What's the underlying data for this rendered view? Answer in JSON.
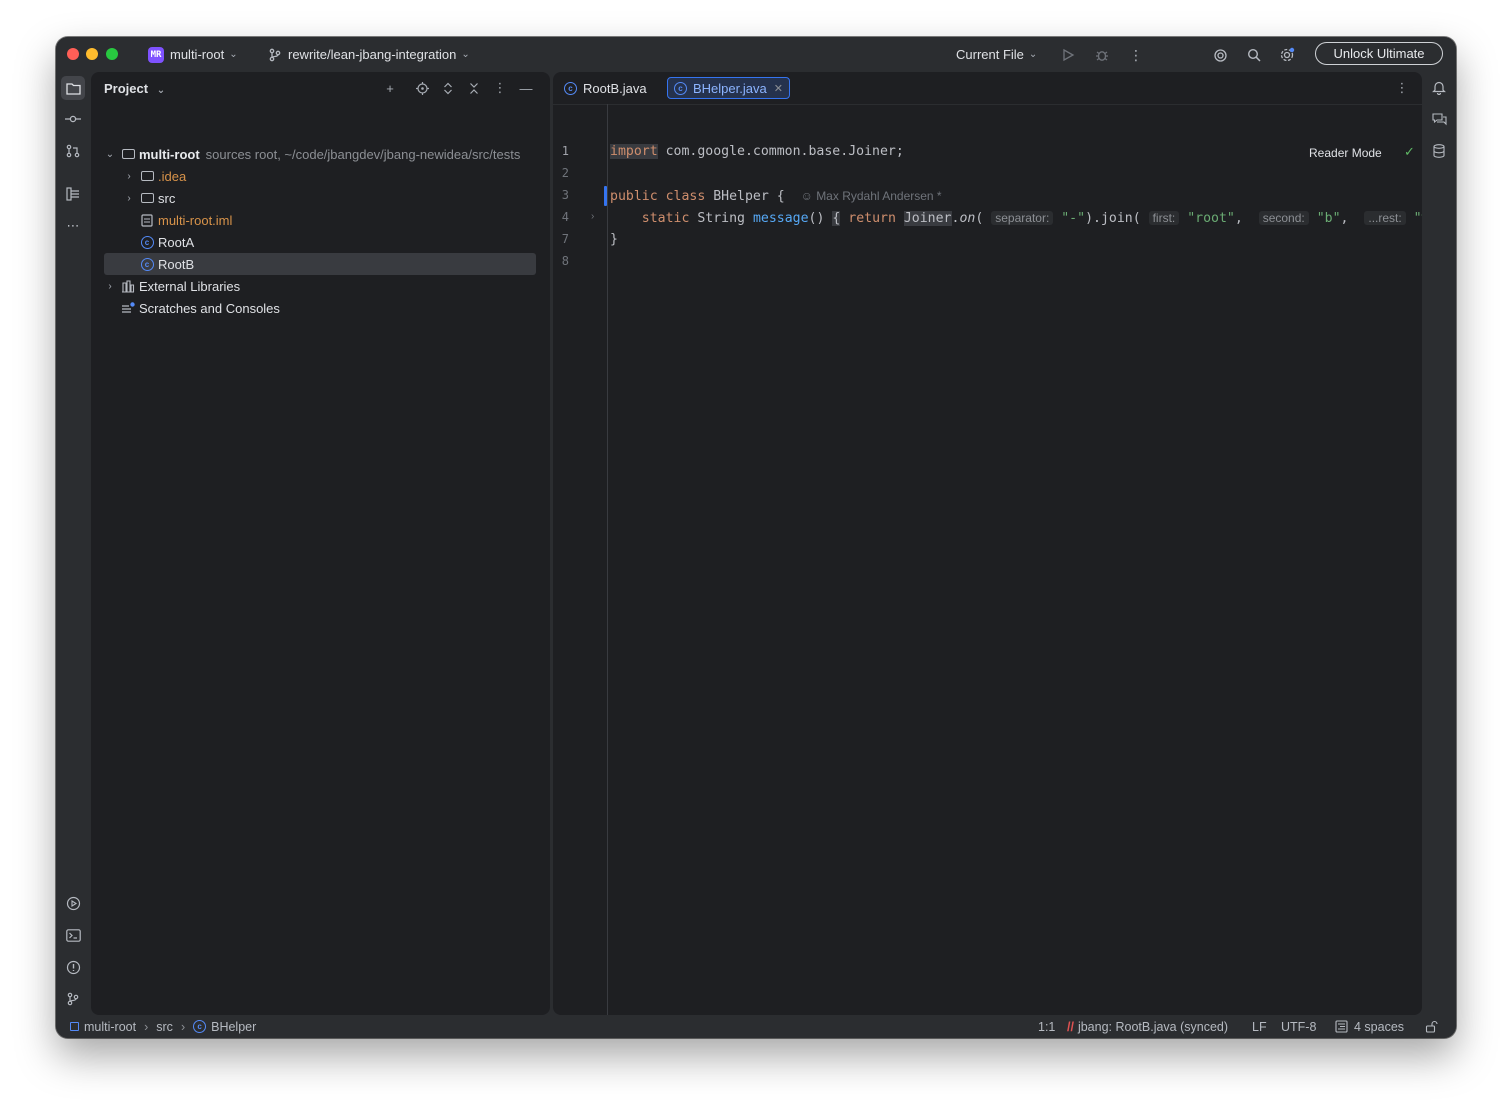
{
  "titlebar": {
    "project_badge": "MR",
    "project_name": "multi-root",
    "branch": "rewrite/lean-jbang-integration",
    "run_config": "Current File",
    "unlock_label": "Unlock Ultimate"
  },
  "project_panel": {
    "title": "Project",
    "tree": {
      "root_name": "multi-root",
      "root_path": "sources root,  ~/code/jbangdev/jbang-newidea/src/tests",
      "idea": ".idea",
      "src": "src",
      "iml": "multi-root.iml",
      "roota": "RootA",
      "rootb": "RootB",
      "external": "External Libraries",
      "scratches": "Scratches and Consoles"
    }
  },
  "editor": {
    "tabs": [
      {
        "label": "RootB.java"
      },
      {
        "label": "BHelper.java"
      }
    ],
    "line_numbers": [
      "1",
      "2",
      "3",
      "4",
      "7",
      "8"
    ],
    "reader_mode": "Reader Mode",
    "code": {
      "l1_kw": "import",
      "l1_rest": " com.google.common.base.Joiner;",
      "l3_kw1": "public",
      "l3_kw2": "class",
      "l3_rest": " BHelper {",
      "l3_blame": "Max Rydahl Andersen *",
      "l4_kw1": "static",
      "l4_type": " String ",
      "l4_fn": "message",
      "l4_paren": "()",
      "l4_brace": "{",
      "l4_kw2": "return",
      "l4_joiner": "Joiner",
      "l4_dot": ".",
      "l4_on": "on",
      "l4_open": "(",
      "hint_sep": "separator:",
      "l4_s1": "\"-\"",
      "l4_join": ").join(",
      "hint_first": "first:",
      "l4_s2": "\"root\"",
      "l4_comma1": ",",
      "hint_second": "second:",
      "l4_s3": "\"b\"",
      "l4_comma2": ",",
      "hint_rest": "...rest:",
      "l4_s4": "\"works",
      "l7": "}"
    }
  },
  "statusbar": {
    "crumb_project": "multi-root",
    "crumb_src": "src",
    "crumb_class": "BHelper",
    "position": "1:1",
    "jbang": "jbang: RootB.java (synced)",
    "line_sep": "LF",
    "encoding": "UTF-8",
    "indent": "4 spaces"
  },
  "colors": {
    "accent": "#3574f0",
    "keyword": "#cf8e6d",
    "string": "#6aab73",
    "function": "#56a8f5",
    "iml_file": "#d8934a"
  }
}
